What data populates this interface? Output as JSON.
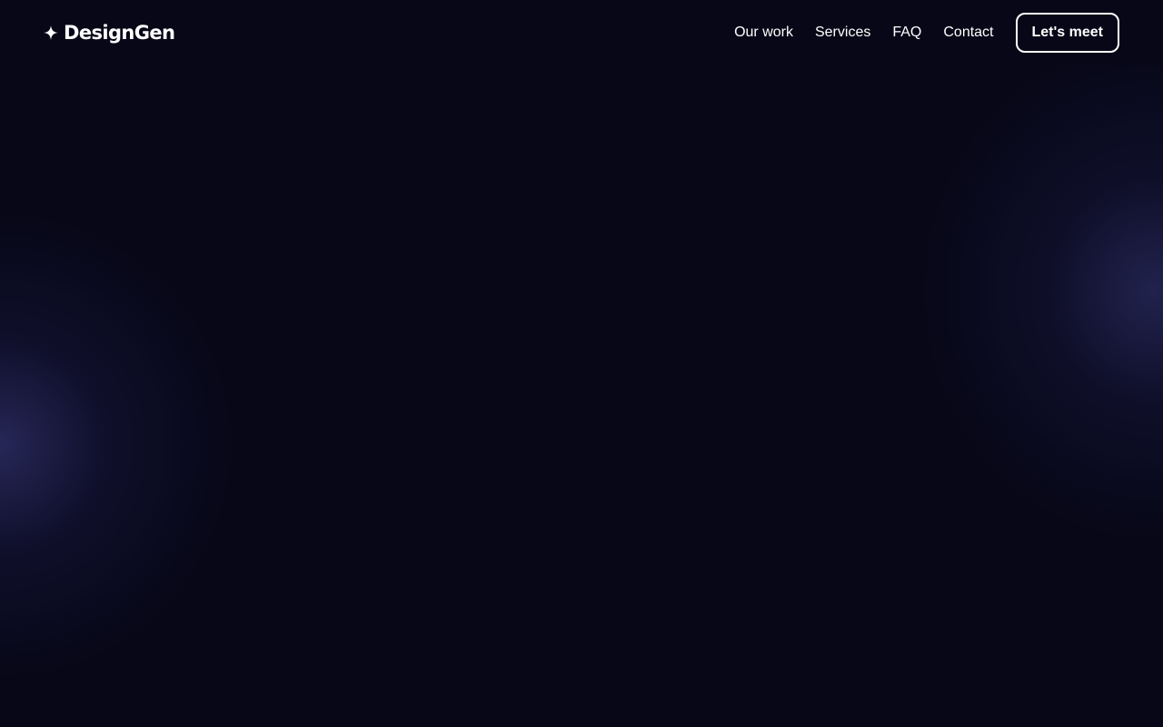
{
  "brand": {
    "name": "DesignGen",
    "icon": "sparkle-icon"
  },
  "nav": {
    "links": [
      {
        "label": "Our work"
      },
      {
        "label": "Services"
      },
      {
        "label": "FAQ"
      },
      {
        "label": "Contact"
      }
    ],
    "cta_label": "Let's meet"
  },
  "colors": {
    "background": "#070717",
    "glow": "#2c2e64",
    "text": "#ffffff"
  }
}
